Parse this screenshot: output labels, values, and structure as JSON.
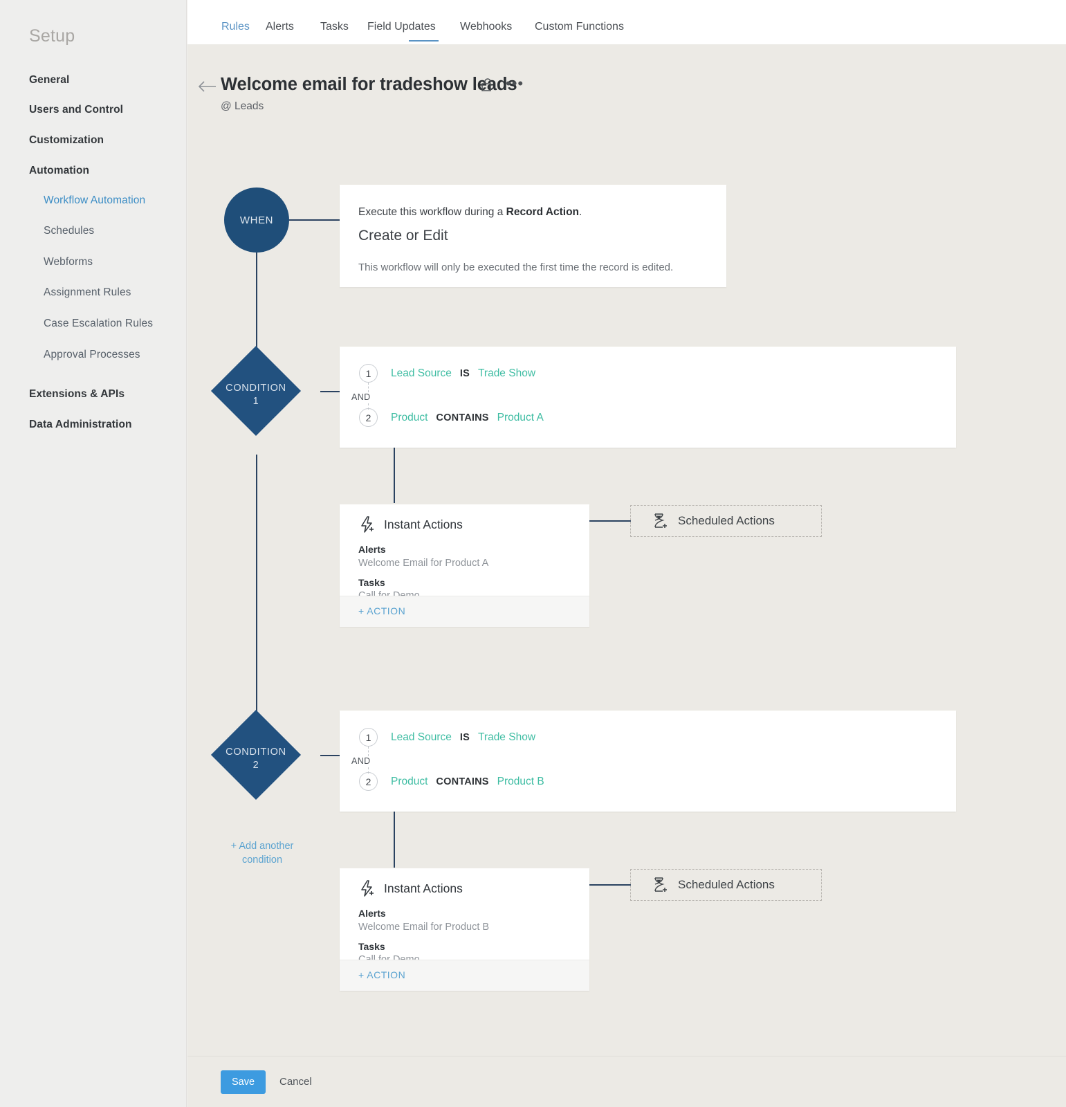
{
  "sidebar": {
    "title": "Setup",
    "items": [
      {
        "label": "General",
        "level": "top",
        "active": false
      },
      {
        "label": "Users and Control",
        "level": "top",
        "active": false
      },
      {
        "label": "Customization",
        "level": "top",
        "active": false
      },
      {
        "label": "Automation",
        "level": "top",
        "active": false
      },
      {
        "label": "Workflow Automation",
        "level": "sub",
        "active": true
      },
      {
        "label": "Schedules",
        "level": "sub",
        "active": false
      },
      {
        "label": "Webforms",
        "level": "sub",
        "active": false
      },
      {
        "label": "Assignment Rules",
        "level": "sub",
        "active": false
      },
      {
        "label": "Case Escalation Rules",
        "level": "sub",
        "active": false
      },
      {
        "label": "Approval Processes",
        "level": "sub",
        "active": false
      },
      {
        "label": "Extensions & APIs",
        "level": "top",
        "active": false
      },
      {
        "label": "Data Administration",
        "level": "top",
        "active": false
      }
    ]
  },
  "tabs": [
    {
      "label": "Rules",
      "active": true
    },
    {
      "label": "Alerts",
      "active": false
    },
    {
      "label": "Tasks",
      "active": false
    },
    {
      "label": "Field Updates",
      "active": false
    },
    {
      "label": "Webhooks",
      "active": false
    },
    {
      "label": "Custom Functions",
      "active": false
    }
  ],
  "header": {
    "back_icon": "arrow-left-icon",
    "title": "Welcome email for tradeshow leads",
    "lock_icon": "unlocked-padlock-icon",
    "more_icon": "•••",
    "module": "@ Leads"
  },
  "flow": {
    "when": {
      "node_label": "WHEN",
      "line_prefix": "Execute this workflow during a ",
      "line_bold": "Record Action",
      "line_suffix": ".",
      "action": "Create or Edit",
      "note": "This workflow will only be executed the first time the record is edited."
    },
    "conditions": [
      {
        "node_label_line1": "CONDITION",
        "node_label_line2": "1",
        "join": "AND",
        "criteria": [
          {
            "num": "1",
            "field": "Lead Source",
            "operator": "IS",
            "value": "Trade Show"
          },
          {
            "num": "2",
            "field": "Product",
            "operator": "CONTAINS",
            "value": "Product A"
          }
        ],
        "instant": {
          "icon": "lightning-plus-icon",
          "title": "Instant Actions",
          "groups": [
            {
              "label": "Alerts",
              "value": "Welcome Email for Product A"
            },
            {
              "label": "Tasks",
              "value": "Call for Demo"
            }
          ],
          "add_action": "+ ACTION"
        },
        "scheduled": {
          "icon": "hourglass-plus-icon",
          "label": "Scheduled Actions"
        }
      },
      {
        "node_label_line1": "CONDITION",
        "node_label_line2": "2",
        "join": "AND",
        "criteria": [
          {
            "num": "1",
            "field": "Lead Source",
            "operator": "IS",
            "value": "Trade Show"
          },
          {
            "num": "2",
            "field": "Product",
            "operator": "CONTAINS",
            "value": "Product B"
          }
        ],
        "instant": {
          "icon": "lightning-plus-icon",
          "title": "Instant Actions",
          "groups": [
            {
              "label": "Alerts",
              "value": "Welcome Email for Product B"
            },
            {
              "label": "Tasks",
              "value": "Call for Demo"
            }
          ],
          "add_action": "+ ACTION"
        },
        "scheduled": {
          "icon": "hourglass-plus-icon",
          "label": "Scheduled Actions"
        }
      }
    ],
    "add_condition": "+ Add another\ncondition"
  },
  "footer": {
    "save_label": "Save",
    "cancel_label": "Cancel"
  },
  "colors": {
    "accent_blue": "#5ba3d0",
    "node_blue": "#22517f",
    "condition_teal": "#3fbda3",
    "save_blue": "#3d9be0",
    "canvas_bg": "#eceae5",
    "sidebar_bg": "#eeeeed"
  }
}
